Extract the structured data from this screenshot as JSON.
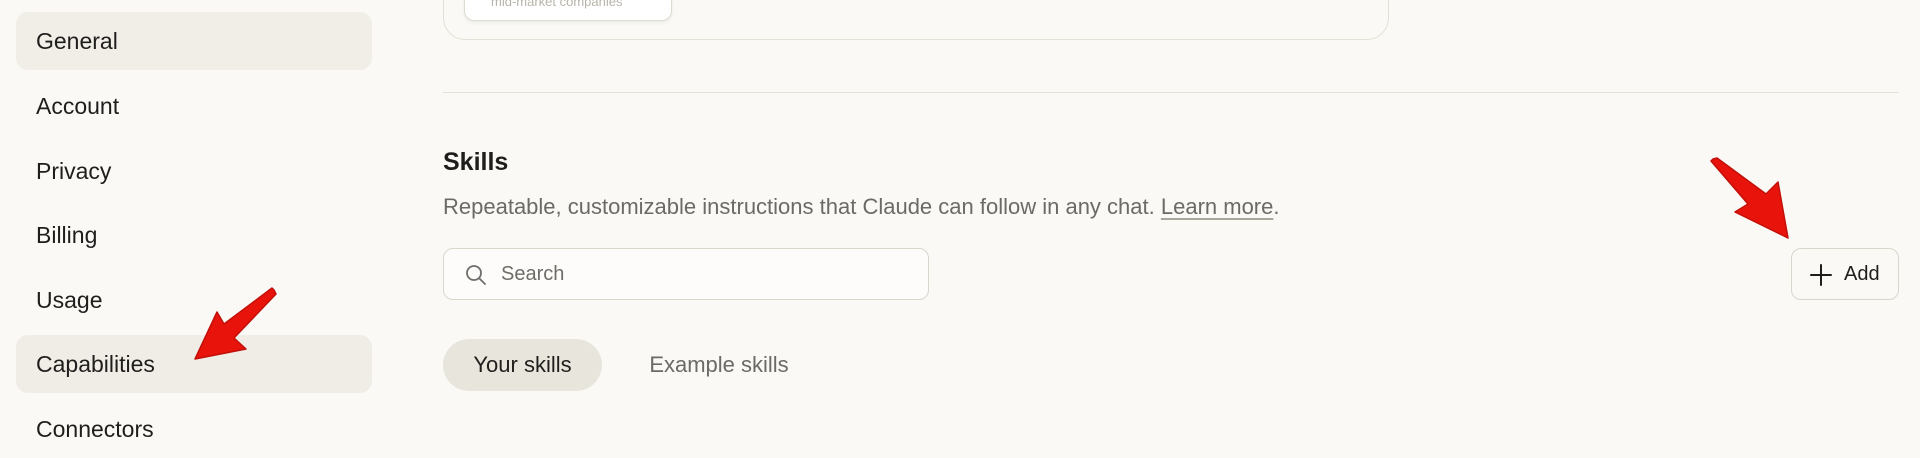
{
  "sidebar": {
    "items": [
      {
        "label": "General"
      },
      {
        "label": "Account"
      },
      {
        "label": "Privacy"
      },
      {
        "label": "Billing"
      },
      {
        "label": "Usage"
      },
      {
        "label": "Capabilities"
      },
      {
        "label": "Connectors"
      }
    ],
    "active_item": "Capabilities"
  },
  "previous_section": {
    "card_text": "mid-market companies"
  },
  "skills": {
    "title": "Skills",
    "description": "Repeatable, customizable instructions that Claude can follow in any chat.",
    "learn_more": "Learn more",
    "period": ".",
    "search": {
      "placeholder": "Search",
      "value": ""
    },
    "add_label": "Add",
    "tabs": [
      {
        "label": "Your skills",
        "selected": true
      },
      {
        "label": "Example skills",
        "selected": false
      }
    ]
  },
  "icons": {
    "search": "search-icon",
    "add": "plus-icon",
    "annotation": "red-arrow-icon"
  },
  "colors": {
    "background": "#faf9f5",
    "active_nav": "#efede5",
    "active_tab": "#e8e6dc",
    "annotation_arrow": "#e8140c"
  }
}
